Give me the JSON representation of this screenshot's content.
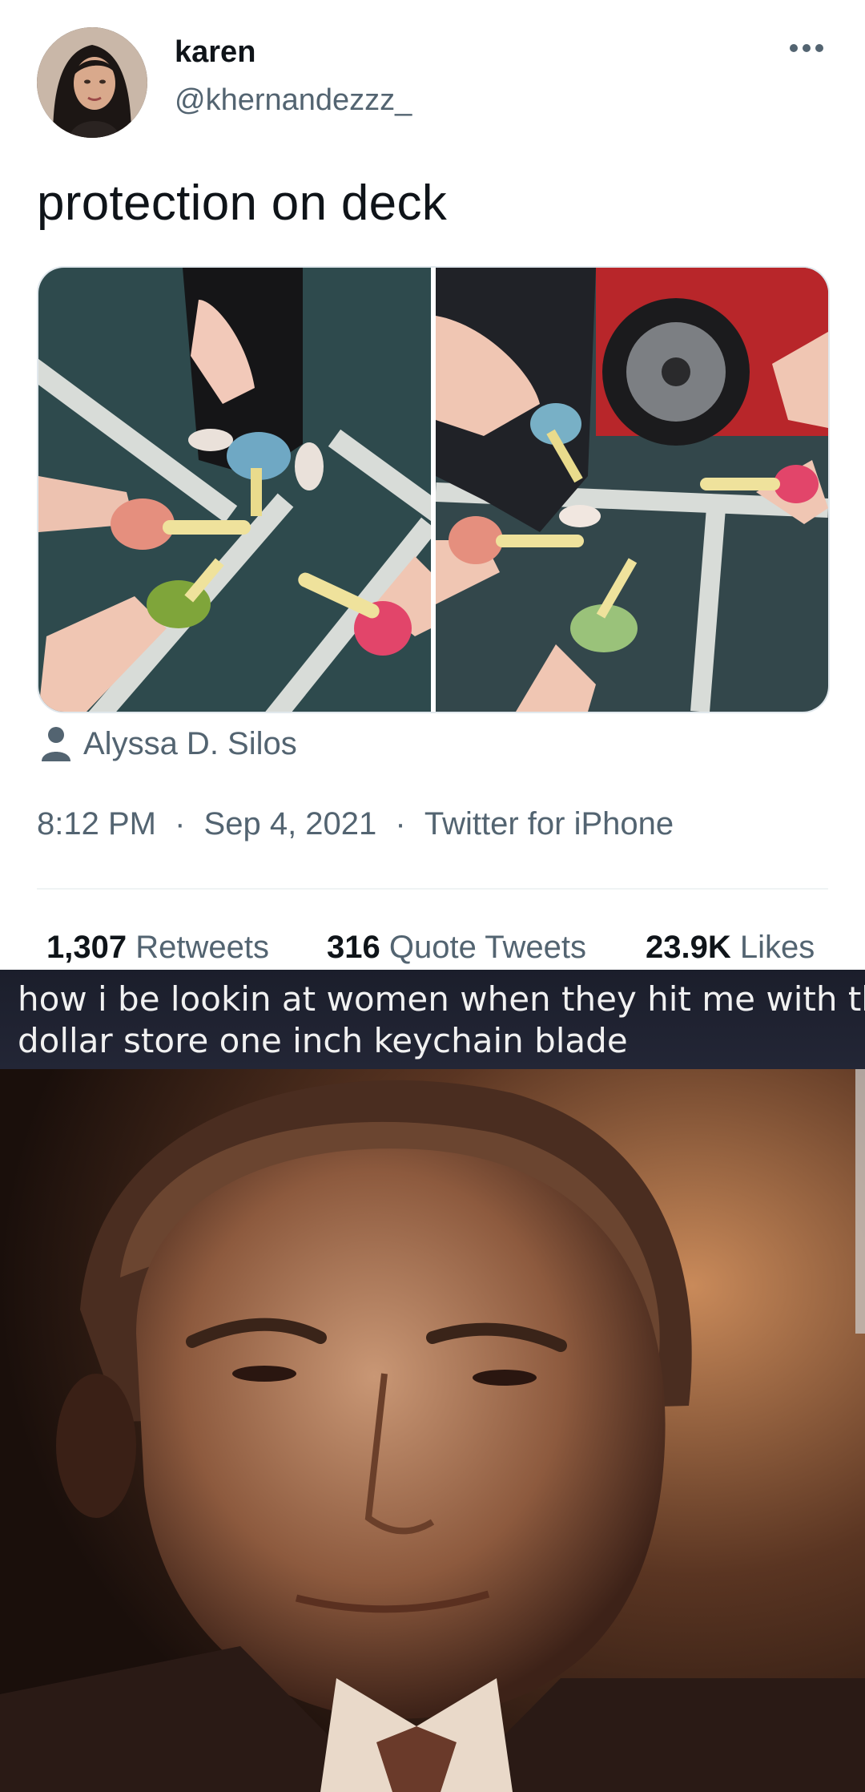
{
  "tweet": {
    "display_name": "karen",
    "handle": "@khernandezzz_",
    "text": "protection on deck",
    "tagged_person": "Alyssa D. Silos",
    "time": "8:12 PM",
    "date": "Sep 4, 2021",
    "client": "Twitter for iPhone",
    "separator": "·",
    "stats": {
      "retweets_count": "1,307",
      "retweets_label": "Retweets",
      "quotes_count": "316",
      "quotes_label": "Quote Tweets",
      "likes_count": "23.9K",
      "likes_label": "Likes"
    },
    "icons": {
      "more": "more-dots-icon",
      "tag": "person-icon"
    }
  },
  "meme": {
    "caption_line1": "how i be lookin at women when they hit me with the",
    "caption_line2": "dollar store one inch keychain blade"
  },
  "colors": {
    "primary_text": "#0f1419",
    "secondary_text": "#536471",
    "divider": "#eff3f4",
    "meme_bar": "#1b1e2b"
  }
}
